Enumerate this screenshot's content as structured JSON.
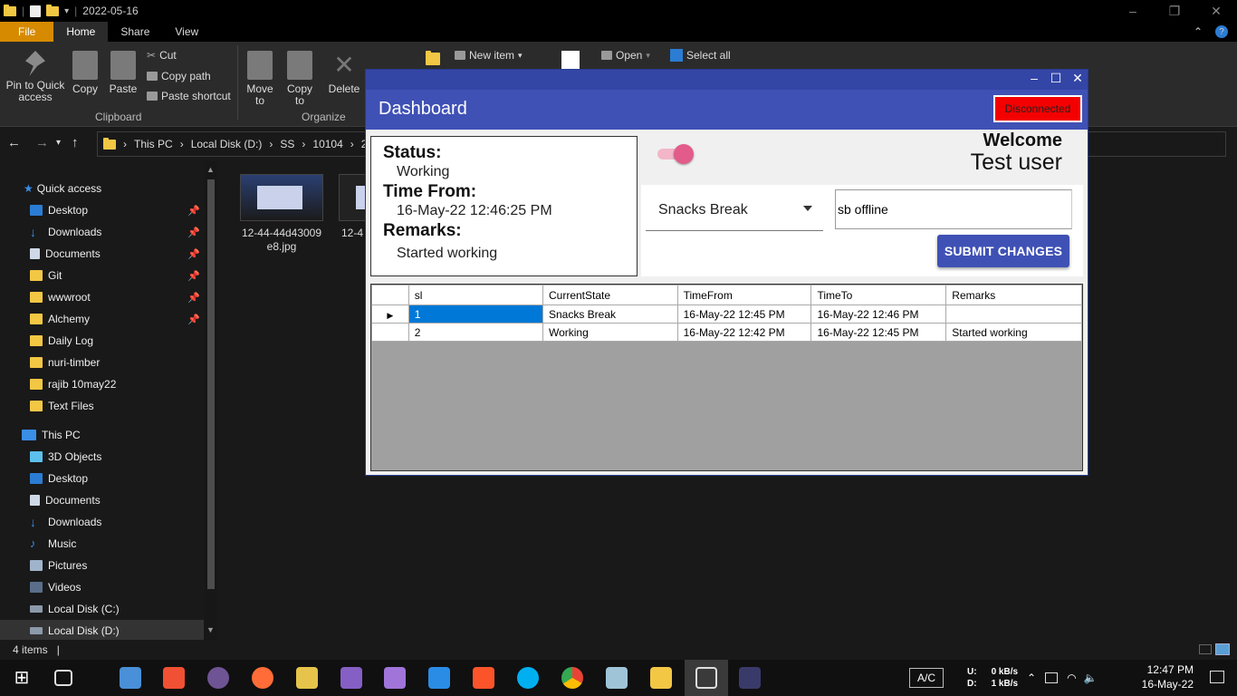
{
  "explorer": {
    "title": "2022-05-16",
    "tabs": [
      "File",
      "Home",
      "Share",
      "View"
    ],
    "ribbon": {
      "pin_label": "Pin to Quick access",
      "copy_label": "Copy",
      "paste_label": "Paste",
      "cut_label": "Cut",
      "copy_path_label": "Copy path",
      "paste_shortcut_label": "Paste shortcut",
      "clipboard_group": "Clipboard",
      "move_to_label": "Move to",
      "copy_to_label": "Copy to",
      "delete_label": "Delete",
      "organize_group": "Organize",
      "new_item_label": "New item",
      "open_label": "Open",
      "select_all_label": "Select all"
    },
    "breadcrumb": [
      "This PC",
      "Local Disk (D:)",
      "SS",
      "10104",
      "20"
    ],
    "nav": {
      "quick_access": "Quick access",
      "pinned": [
        "Desktop",
        "Downloads",
        "Documents",
        "Git",
        "wwwroot",
        "Alchemy"
      ],
      "unpinned": [
        "Daily Log",
        "nuri-timber",
        "rajib 10may22",
        "Text Files"
      ],
      "this_pc": "This PC",
      "pc_items": [
        "3D Objects",
        "Desktop",
        "Documents",
        "Downloads",
        "Music",
        "Pictures",
        "Videos",
        "Local Disk (C:)",
        "Local Disk (D:)"
      ]
    },
    "files": [
      "12-44-44d43009e8.jpg",
      "12-4"
    ],
    "status": "4 items"
  },
  "taskbar": {
    "ac_label": "A/C",
    "net_u_label": "U:",
    "net_d_label": "D:",
    "net_u": "0 kB/s",
    "net_d": "1 kB/s",
    "time": "12:47 PM",
    "date": "16-May-22"
  },
  "app": {
    "header_title": "Dashboard",
    "connection_status": "Disconnected",
    "status_label": "Status:",
    "status_value": "Working",
    "time_from_label": "Time From:",
    "time_from_value": "16-May-22 12:46:25 PM",
    "remarks_label": "Remarks:",
    "remarks_value": "Started working",
    "welcome": "Welcome",
    "username": "Test user",
    "state_select": "Snacks Break",
    "remarks_input": "sb offline",
    "submit_label": "SUBMIT CHANGES",
    "toggle_on": true,
    "grid": {
      "columns": [
        "sl",
        "CurrentState",
        "TimeFrom",
        "TimeTo",
        "Remarks"
      ],
      "rows": [
        {
          "sl": "1",
          "CurrentState": "Snacks Break",
          "TimeFrom": "16-May-22 12:45 PM",
          "TimeTo": "16-May-22 12:46 PM",
          "Remarks": ""
        },
        {
          "sl": "2",
          "CurrentState": "Working",
          "TimeFrom": "16-May-22 12:42 PM",
          "TimeTo": "16-May-22 12:45 PM",
          "Remarks": "Started working"
        }
      ]
    }
  }
}
